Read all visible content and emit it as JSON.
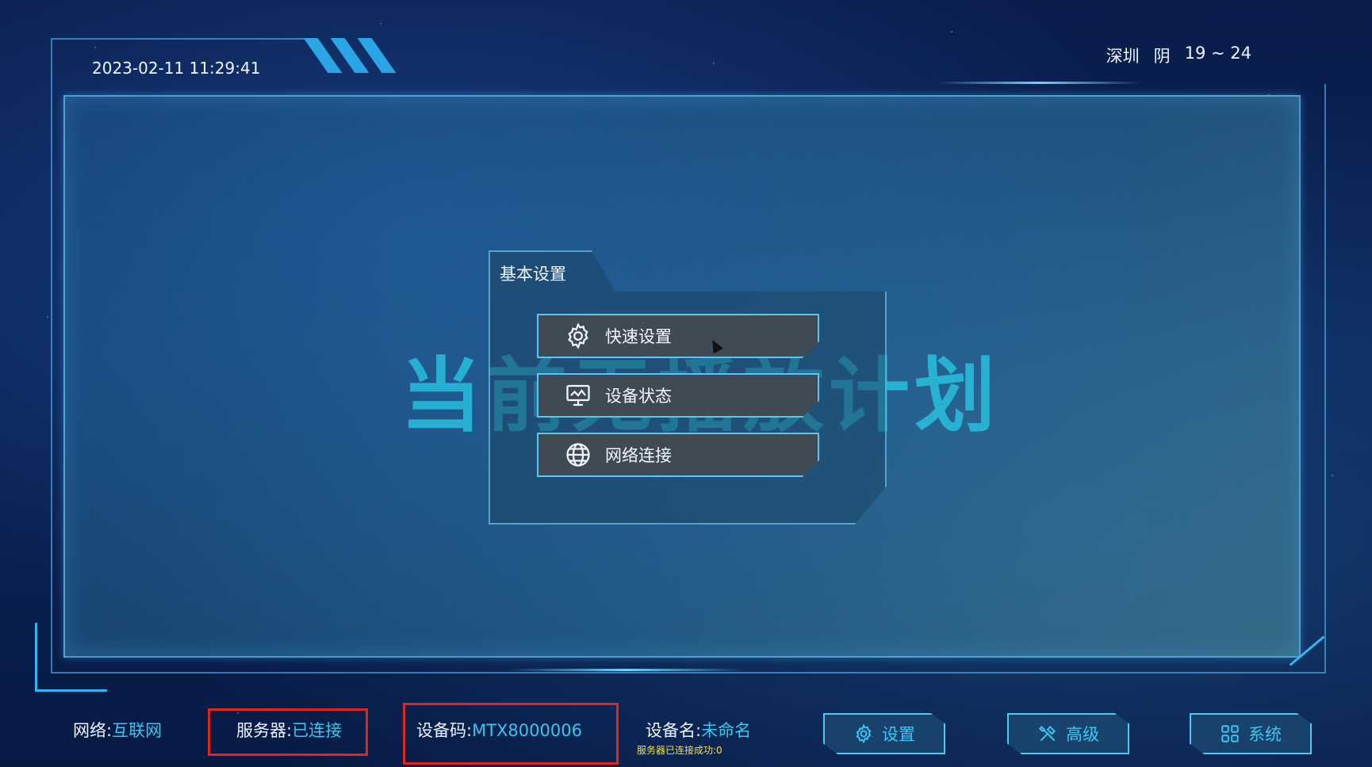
{
  "header": {
    "datetime": "2023-02-11 11:29:41",
    "weather": {
      "city": "深圳",
      "condition": "阴",
      "temperature": "19 ~ 24"
    }
  },
  "main": {
    "watermark_text": "当前无播放计划"
  },
  "panel": {
    "title": "基本设置",
    "items": [
      {
        "label": "快速设置",
        "icon": "gear-icon"
      },
      {
        "label": "设备状态",
        "icon": "monitor-icon"
      },
      {
        "label": "网络连接",
        "icon": "globe-icon"
      }
    ]
  },
  "footer": {
    "network": {
      "label": "网络:",
      "value": "互联网"
    },
    "server": {
      "label": "服务器:",
      "value": "已连接"
    },
    "device_code": {
      "label": "设备码:",
      "value": "MTX8000006"
    },
    "device_name": {
      "label": "设备名:",
      "value": "未命名",
      "note": "服务器已连接成功:0"
    },
    "buttons": [
      {
        "label": "设置",
        "icon": "gear-icon"
      },
      {
        "label": "高级",
        "icon": "tools-icon"
      },
      {
        "label": "系统",
        "icon": "grid-icon"
      }
    ]
  },
  "colors": {
    "accent": "#36c8f0",
    "highlight_border": "#e0261c",
    "note": "#f0e04a"
  }
}
